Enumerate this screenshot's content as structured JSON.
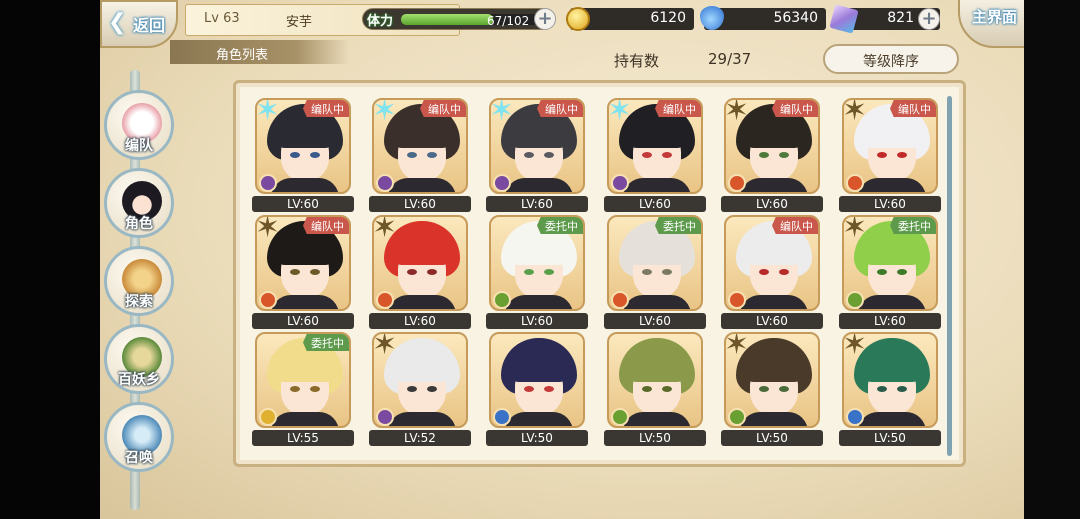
{
  "header": {
    "back_label": "返回",
    "home_label": "主界面",
    "player_level": "Lv 63",
    "player_name": "安芋",
    "stamina_label": "体力",
    "stamina_text": "67/102",
    "stamina_fraction": 0.657,
    "gold": "6120",
    "soul": "56340",
    "crystal": "821"
  },
  "list": {
    "title": "角色列表",
    "owned_label": "持有数",
    "owned_value": "29/37",
    "sort_label": "等级降序"
  },
  "side_menu": [
    {
      "label": "编队",
      "icon": "team-icon"
    },
    {
      "label": "角色",
      "icon": "character-icon"
    },
    {
      "label": "探索",
      "icon": "explore-icon"
    },
    {
      "label": "百妖乡",
      "icon": "village-icon"
    },
    {
      "label": "召唤",
      "icon": "summon-icon"
    }
  ],
  "characters": [
    {
      "level": "LV:60",
      "status": "编队中",
      "star": "cyan",
      "element": "purple",
      "hair": "#2a2a33",
      "eye": "#3a5a8c"
    },
    {
      "level": "LV:60",
      "status": "编队中",
      "star": "cyan",
      "element": "purple",
      "hair": "#3a2f2a",
      "eye": "#4a6a8a"
    },
    {
      "level": "LV:60",
      "status": "编队中",
      "star": "cyan",
      "element": "purple",
      "hair": "#3b3b40",
      "eye": "#5a5a60"
    },
    {
      "level": "LV:60",
      "status": "编队中",
      "star": "cyan",
      "element": "purple",
      "hair": "#1f1f24",
      "eye": "#c23a3a"
    },
    {
      "level": "LV:60",
      "status": "编队中",
      "star": "gold",
      "element": "fire",
      "hair": "#2c2621",
      "eye": "#4d7a3a"
    },
    {
      "level": "LV:60",
      "status": "编队中",
      "star": "gold",
      "element": "fire",
      "hair": "#f1f1f4",
      "eye": "#c22a2a"
    },
    {
      "level": "LV:60",
      "status": "编队中",
      "star": "gold",
      "element": "fire",
      "hair": "#1e1a18",
      "eye": "#6a5a2a"
    },
    {
      "level": "LV:60",
      "status": "",
      "star": "gold",
      "element": "fire",
      "hair": "#d9332a",
      "eye": "#8a2a2a"
    },
    {
      "level": "LV:60",
      "status": "委托中",
      "star": "",
      "element": "wind",
      "hair": "#f4f6ef",
      "eye": "#5aa04a"
    },
    {
      "level": "LV:60",
      "status": "委托中",
      "star": "",
      "element": "fire",
      "hair": "#e6e0da",
      "eye": "#7a7a60"
    },
    {
      "level": "LV:60",
      "status": "编队中",
      "star": "",
      "element": "fire",
      "hair": "#ececec",
      "eye": "#b72a2a"
    },
    {
      "level": "LV:60",
      "status": "委托中",
      "star": "gold",
      "element": "wind",
      "hair": "#8fcf4a",
      "eye": "#3a7a2a"
    },
    {
      "level": "LV:55",
      "status": "委托中",
      "star": "",
      "element": "light",
      "hair": "#f0dc8a",
      "eye": "#8a6a2a"
    },
    {
      "level": "LV:52",
      "status": "",
      "star": "gold",
      "element": "purple",
      "hair": "#eaeaea",
      "eye": "#3a3a3a"
    },
    {
      "level": "LV:50",
      "status": "",
      "star": "",
      "element": "water",
      "hair": "#2a2a55",
      "eye": "#c23a3a"
    },
    {
      "level": "LV:50",
      "status": "",
      "star": "",
      "element": "wind",
      "hair": "#8a9a4a",
      "eye": "#5a6a2a"
    },
    {
      "level": "LV:50",
      "status": "",
      "star": "gold",
      "element": "wind",
      "hair": "#4a3a2a",
      "eye": "#4a6a3a"
    },
    {
      "level": "LV:50",
      "status": "",
      "star": "gold",
      "element": "water",
      "hair": "#2a7a5a",
      "eye": "#2a5a4a"
    }
  ],
  "colors": {
    "team_badge": "#c9574c",
    "task_badge": "#5e9a4c",
    "star_cyan": "#7fe3f0",
    "star_gold": "#6e5628",
    "element_purple": "#7a4aa0",
    "element_fire": "#d9552a",
    "element_wind": "#6aa032",
    "element_water": "#3a72c8",
    "element_light": "#e0b030"
  }
}
